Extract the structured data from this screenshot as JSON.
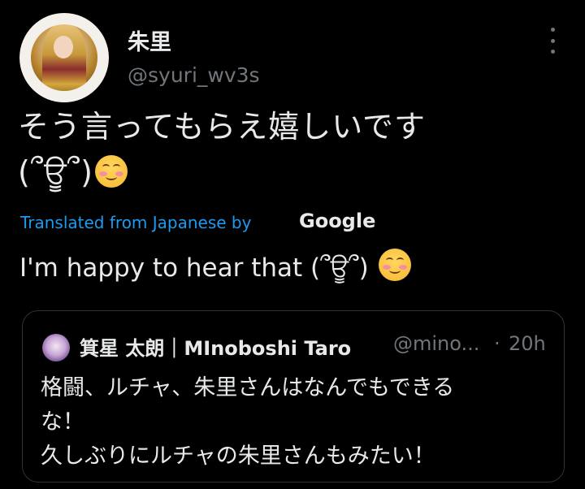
{
  "author": {
    "display_name": "朱里",
    "handle": "@syuri_wv3s"
  },
  "tweet": {
    "text_line1": "そう言ってもらえ嬉しいです",
    "text_line2": "(՞ਊ՞)",
    "emoji": "smiling-face-with-smiling-eyes"
  },
  "translation": {
    "label": "Translated from Japanese by",
    "provider": "Google",
    "text": "I'm happy to hear that (՞ਊ՞)"
  },
  "quoted_tweet": {
    "display_name": "箕星 太朗｜MInoboshi Taro",
    "handle": "@mino...",
    "separator": "·",
    "time": "20h",
    "text": "格闘、ルチャ、朱里さんはなんでもできる\nな！\n久しぶりにルチャの朱里さんもみたい！"
  },
  "colors": {
    "background": "#000000",
    "text": "#e7e9ea",
    "muted": "#71767b",
    "link": "#1d9bf0",
    "border": "#2f3336"
  }
}
